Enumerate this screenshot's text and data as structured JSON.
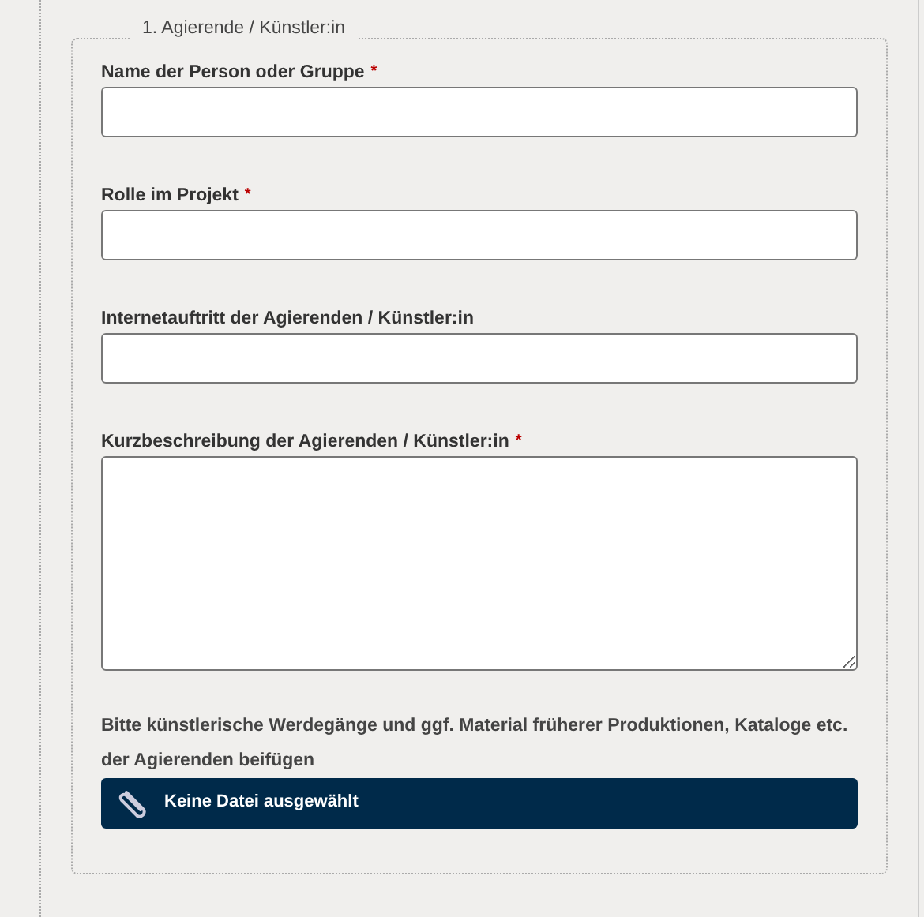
{
  "fieldset": {
    "legend": "1. Agierende / Künstler:in",
    "fields": [
      {
        "kind": "input",
        "label": "Name der Person oder Gruppe",
        "required_mark": "*"
      },
      {
        "kind": "input",
        "label": "Rolle im Projekt",
        "required_mark": "*"
      },
      {
        "kind": "input",
        "label": "Internetauftritt der Agierenden / Künstler:in"
      },
      {
        "kind": "textarea",
        "label": "Kurzbeschreibung der Agierenden / Künstler:in",
        "required_mark": "*"
      },
      {
        "kind": "file",
        "label": "Bitte künstlerische Werdegänge und ggf. Material früherer Produktionen, Kataloge etc. der Agierenden beifügen",
        "button": "Keine Datei ausgewählt"
      }
    ]
  }
}
